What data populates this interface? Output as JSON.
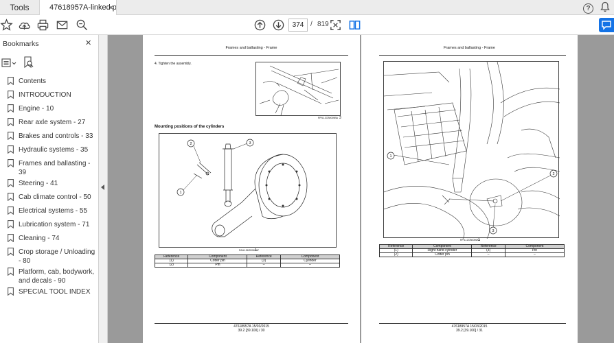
{
  "tabs": {
    "tools_label": "Tools",
    "document_label": "47618957A-linked p...",
    "close_symbol": "×"
  },
  "toolbar": {
    "current_page": "374",
    "separator": "/",
    "total_pages": "819",
    "accent_color": "#1473e6"
  },
  "sidebar": {
    "title": "Bookmarks",
    "close_symbol": "×",
    "items": [
      {
        "label": "Contents"
      },
      {
        "label": "INTRODUCTION"
      },
      {
        "label": "Engine - 10"
      },
      {
        "label": "Rear axle system - 27"
      },
      {
        "label": "Brakes and controls - 33"
      },
      {
        "label": "Hydraulic systems - 35"
      },
      {
        "label": "Frames and ballasting - 39"
      },
      {
        "label": "Steering - 41"
      },
      {
        "label": "Cab climate control - 50"
      },
      {
        "label": "Electrical systems - 55"
      },
      {
        "label": "Lubrication system - 71"
      },
      {
        "label": "Cleaning - 74"
      },
      {
        "label": "Crop storage / Unloading - 80"
      },
      {
        "label": "Platform, cab, bodywork, and decals - 90"
      },
      {
        "label": "SPECIAL TOOL INDEX"
      }
    ]
  },
  "left_page": {
    "header": "Frames and ballasting - Frame",
    "step": "4.   Tighten the assembly.",
    "fig1_code": "RPIL12CB0005BA",
    "fig1_num": "3",
    "section_title": "Mounting positions of the cylinders",
    "fig2_code": "RAIL19MS0062AF",
    "fig2_num": "1",
    "callouts": [
      "1",
      "2",
      "3"
    ],
    "table": {
      "headers": [
        "Reference",
        "Component",
        "Reference",
        "Component"
      ],
      "rows": [
        [
          "(1)",
          "Cotter pin",
          "(3)",
          "Cylinder"
        ],
        [
          "(2)",
          "Pin",
          "–",
          "–"
        ]
      ]
    },
    "footer_line1": "47618957A 15/03/2015",
    "footer_line2": "39.2 [39.100] / 30"
  },
  "right_page": {
    "header": "Frames and ballasting - Frame",
    "fig_code": "RPIL12CB0006AA",
    "fig_num": "1",
    "callouts": [
      "1",
      "2",
      "3"
    ],
    "table": {
      "headers": [
        "Reference",
        "Component",
        "Reference",
        "Component"
      ],
      "rows": [
        [
          "(1)",
          "Right hand cylinder",
          "(3)",
          "Pin"
        ],
        [
          "(2)",
          "Cotter pin",
          "–",
          "–"
        ]
      ]
    },
    "footer_line1": "47618957A 15/03/2015",
    "footer_line2": "39.2 [39.100] / 31"
  }
}
